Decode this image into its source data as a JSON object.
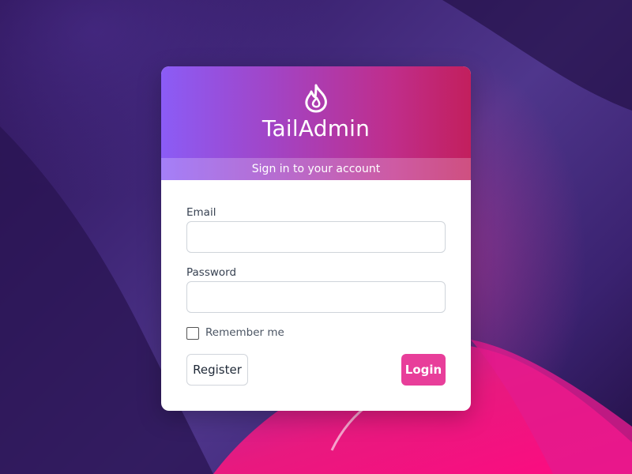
{
  "brand": {
    "name": "TailAdmin",
    "logo_icon": "flame-icon"
  },
  "subtitle": "Sign in to your account",
  "form": {
    "email_label": "Email",
    "email_value": "",
    "password_label": "Password",
    "password_value": "",
    "remember_label": "Remember me",
    "remember_checked": false
  },
  "buttons": {
    "register": "Register",
    "login": "Login"
  },
  "colors": {
    "header_gradient_start": "#8b5cf6",
    "header_gradient_end": "#c21f5d",
    "login_button": "#e83e9a"
  }
}
